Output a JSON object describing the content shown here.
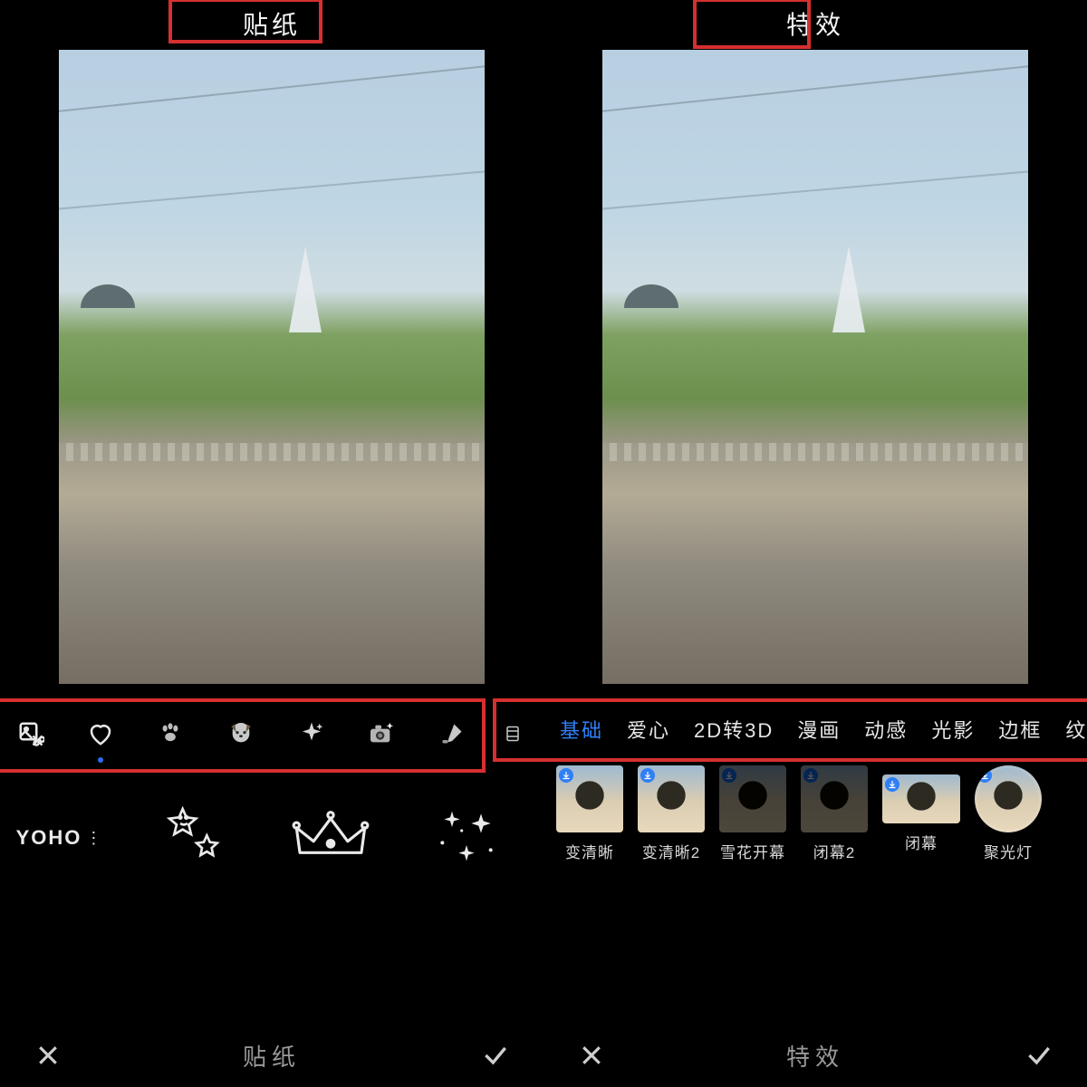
{
  "left": {
    "title": "贴纸",
    "toolbar_icons": [
      "image-cut-icon",
      "heart-icon",
      "paw-icon",
      "dog-icon",
      "sparkle-icon",
      "camera-flash-icon",
      "brush-icon",
      "film-icon"
    ],
    "selected_tool_index": 1,
    "stickers": [
      {
        "name": "yoho-sticker",
        "label": "YOHO"
      },
      {
        "name": "stars-sticker",
        "label": "stars"
      },
      {
        "name": "crown-sticker",
        "label": "crown"
      },
      {
        "name": "sparkles-sticker",
        "label": "sparkles"
      }
    ],
    "bottom_label": "贴纸"
  },
  "right": {
    "title": "特效",
    "tabs": [
      "基础",
      "爱心",
      "2D转3D",
      "漫画",
      "动感",
      "光影",
      "边框",
      "纹理"
    ],
    "active_tab_index": 0,
    "effects": [
      {
        "label": "变清晰",
        "shape": "square"
      },
      {
        "label": "变清晰2",
        "shape": "square"
      },
      {
        "label": "雪花开幕",
        "shape": "dark"
      },
      {
        "label": "闭幕2",
        "shape": "dark"
      },
      {
        "label": "闭幕",
        "shape": "wide"
      },
      {
        "label": "聚光灯",
        "shape": "round"
      }
    ],
    "bottom_label": "特效"
  },
  "colors": {
    "highlight": "#d62f2f",
    "accent": "#2f7ff5"
  }
}
